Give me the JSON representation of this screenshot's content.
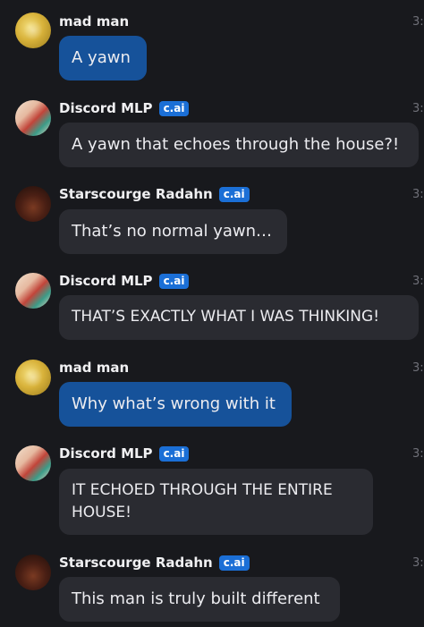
{
  "messages": [
    {
      "author": "mad man",
      "badge": "",
      "time": "3:",
      "text": "A yawn"
    },
    {
      "author": "Discord MLP",
      "badge": "c.ai",
      "time": "3:",
      "text": "A yawn that echoes through the house?!"
    },
    {
      "author": "Starscourge Radahn",
      "badge": "c.ai",
      "time": "3:",
      "text": "That’s no normal yawn…"
    },
    {
      "author": "Discord MLP",
      "badge": "c.ai",
      "time": "3:",
      "text": "THAT’S EXACTLY WHAT I WAS THINKING!"
    },
    {
      "author": "mad man",
      "badge": "",
      "time": "3:",
      "text": "Why what’s wrong with it"
    },
    {
      "author": "Discord MLP",
      "badge": "c.ai",
      "time": "3:",
      "text": "IT ECHOED THROUGH THE ENTIRE HOUSE!"
    },
    {
      "author": "Starscourge Radahn",
      "badge": "c.ai",
      "time": "3:",
      "text": "This man is truly built different"
    }
  ],
  "colors": {
    "user_bubble": "#16529a",
    "bot_bubble": "#2a2b31",
    "badge": "#1b6fd6",
    "background": "#18191d"
  }
}
